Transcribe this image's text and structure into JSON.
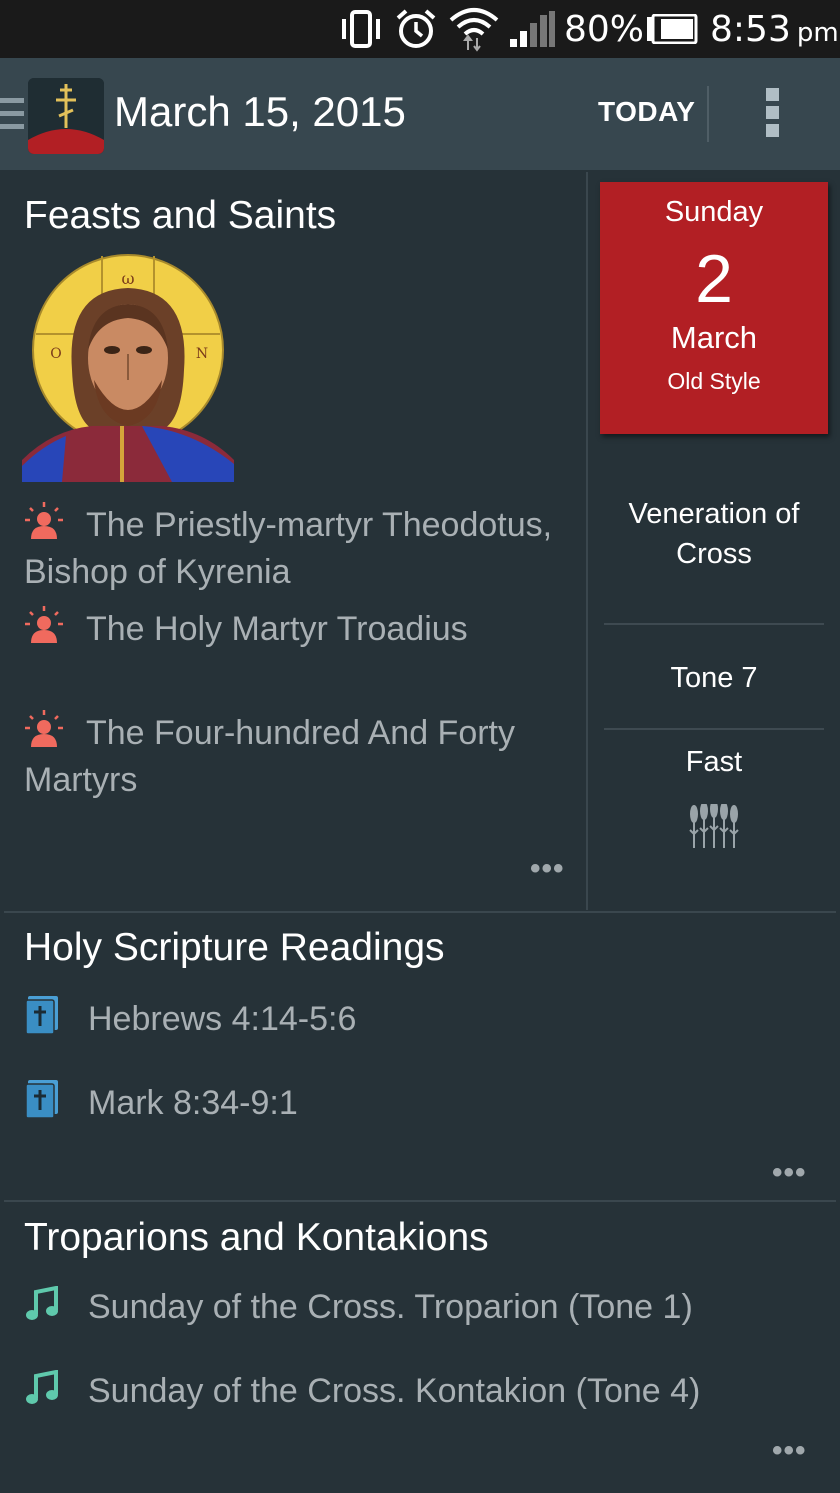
{
  "status_bar": {
    "battery_percent": "80%",
    "time": "8:53",
    "ampm": "pm",
    "icons": [
      "vibrate-icon",
      "alarm-icon",
      "wifi-icon",
      "signal-icon",
      "battery-icon"
    ]
  },
  "app_bar": {
    "date_title": "March 15, 2015",
    "today_label": "TODAY",
    "logo": "orthodox-cross-logo",
    "menu_icon": "menu-icon",
    "overflow_icon": "more-vert-icon"
  },
  "feasts": {
    "title": "Feasts and Saints",
    "icon_letters": {
      "top": "ω",
      "left": "Ο",
      "right": "Ν"
    },
    "saints": [
      {
        "name": "The Priestly-martyr Theodotus, Bishop of Kyrenia",
        "icon": "martyr-icon"
      },
      {
        "name": "The Holy Martyr Troadius",
        "icon": "martyr-icon"
      },
      {
        "name": "The Four-hundred And Forty Martyrs",
        "icon": "martyr-icon"
      }
    ],
    "more": "•••"
  },
  "old_style": {
    "weekday": "Sunday",
    "day": "2",
    "month": "March",
    "caption": "Old Style"
  },
  "day_info": {
    "feast": "Veneration of Cross",
    "tone": "Tone 7",
    "fast": "Fast",
    "fast_icon": "wheat-icon"
  },
  "readings": {
    "title": "Holy Scripture Readings",
    "items": [
      {
        "text": "Hebrews 4:14-5:6",
        "icon": "bible-icon"
      },
      {
        "text": "Mark 8:34-9:1",
        "icon": "bible-icon"
      }
    ],
    "more": "•••"
  },
  "troparia": {
    "title": "Troparions and Kontakions",
    "items": [
      {
        "text": "Sunday of the Cross. Troparion (Tone 1)",
        "icon": "music-note-icon"
      },
      {
        "text": "Sunday of the Cross. Kontakion (Tone 4)",
        "icon": "music-note-icon"
      }
    ],
    "more": "•••"
  },
  "colors": {
    "background": "#263238",
    "app_bar": "#37474f",
    "accent_red": "#b21f24",
    "martyr_icon": "#f06a5e",
    "bible_icon": "#4a9fd5",
    "note_icon": "#5fc9ac"
  }
}
